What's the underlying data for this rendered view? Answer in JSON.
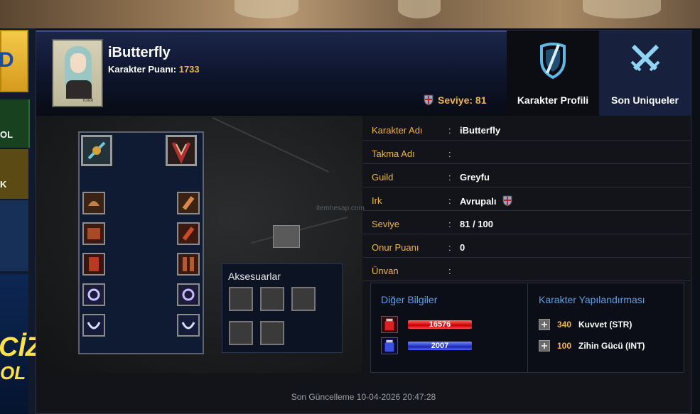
{
  "sidebar": {
    "gold_badge_text": "D",
    "green_item_text": "OL",
    "olive_item_text": "K",
    "poster_line1": "CİZ",
    "poster_line2": "OL"
  },
  "character": {
    "name": "iButterfly",
    "score_label": "Karakter Puanı:",
    "score_value": "1733",
    "level_label": "Seviye: 81",
    "portrait_caption": "Kxkxi"
  },
  "tabs": [
    {
      "label": "Karakter Profili",
      "icon": "shield-sword-icon"
    },
    {
      "label": "Son Uniqueler",
      "icon": "crossed-swords-icon"
    }
  ],
  "info": [
    {
      "key": "Karakter Adı",
      "value": "iButterfly"
    },
    {
      "key": "Takma Adı",
      "value": ""
    },
    {
      "key": "Guild",
      "value": "Greyfu"
    },
    {
      "key": "Irk",
      "value": "Avrupalı"
    },
    {
      "key": "Seviye",
      "value": "81 / 100"
    },
    {
      "key": "Onur Puanı",
      "value": "0"
    },
    {
      "key": "Ünvan",
      "value": ""
    }
  ],
  "separator": ":",
  "accessories": {
    "title": "Aksesuarlar"
  },
  "watermark": "itemhesap.com",
  "other_info": {
    "title": "Diğer Bilgiler",
    "hp": "16576",
    "mp": "2007"
  },
  "build": {
    "title": "Karakter Yapılandırması",
    "stats": [
      {
        "value": "340",
        "label": "Kuvvet (STR)"
      },
      {
        "value": "100",
        "label": "Zihin Gücü (INT)"
      }
    ]
  },
  "last_update": "Son Güncelleme 10-04-2026 20:47:28",
  "colors": {
    "accent": "#f0b64a",
    "link_blue": "#5ca0e8",
    "hp": "#c40000",
    "mp": "#1a2ab0"
  }
}
